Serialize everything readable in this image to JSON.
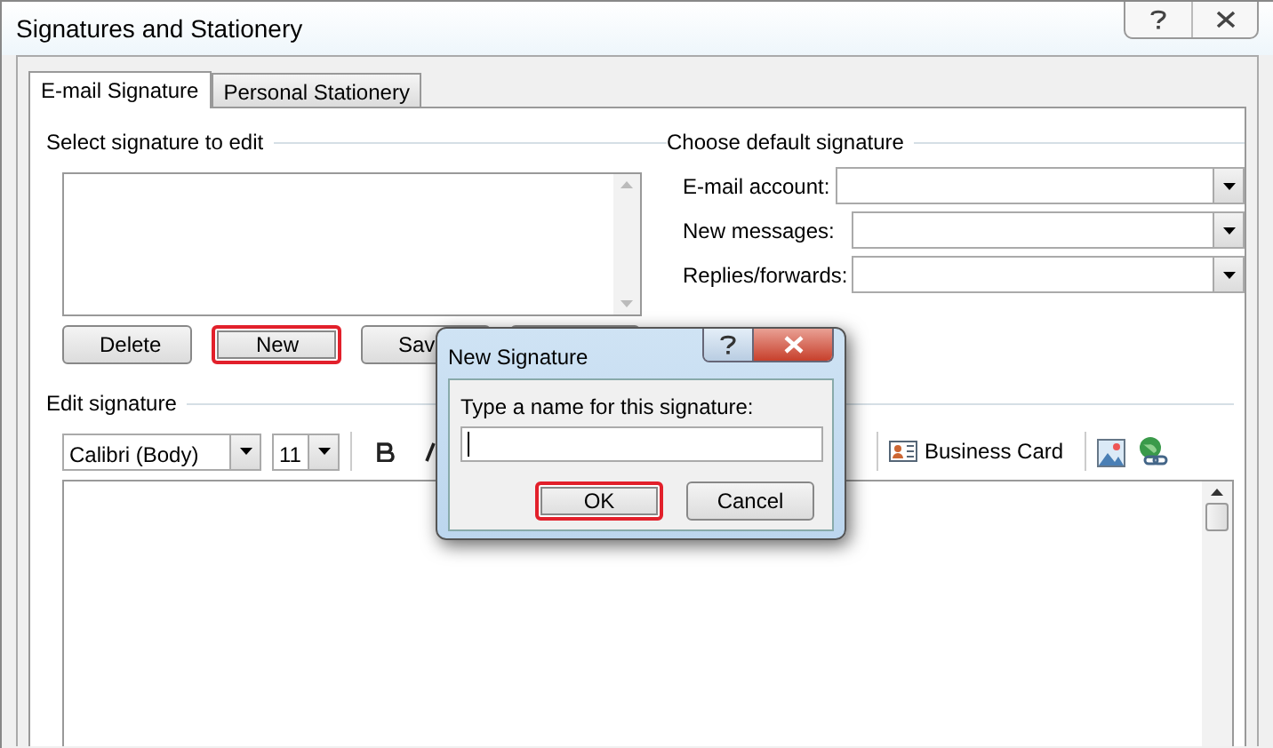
{
  "window": {
    "title": "Signatures and Stationery"
  },
  "tabs": [
    {
      "label": "E-mail Signature",
      "selected": true
    },
    {
      "label": "Personal Stationery",
      "selected": false
    }
  ],
  "select_signature": {
    "label": "Select signature to edit",
    "buttons": [
      {
        "label": "Delete",
        "highlighted": false
      },
      {
        "label": "New",
        "highlighted": true
      },
      {
        "label": "Sav",
        "highlighted": false
      },
      {
        "highlighted": false
      }
    ]
  },
  "default_signature": {
    "label": "Choose default signature",
    "fields": [
      {
        "label": "E-mail account:"
      },
      {
        "label": "New messages:"
      },
      {
        "label": "Replies/forwards:"
      }
    ]
  },
  "edit_signature": {
    "label": "Edit signature",
    "font": "Calibri (Body)",
    "size": "11",
    "business_card": "Business Card"
  },
  "dialog": {
    "title": "New Signature",
    "prompt": "Type a name for this signature:",
    "buttons": [
      {
        "label": "OK",
        "highlighted": true
      },
      {
        "label": "Cancel",
        "highlighted": false
      }
    ]
  }
}
